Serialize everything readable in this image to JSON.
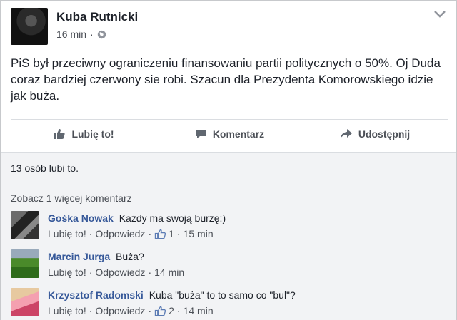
{
  "post": {
    "author": "Kuba Rutnicki",
    "time": "16 min",
    "separator": "·",
    "text": "PiS był przeciwny ograniczeniu finansowaniu partii politycznych o 50%. Oj Duda coraz bardziej czerwony sie robi. Szacun dla Prezydenta Komorowskiego idzie jak buża."
  },
  "actions": {
    "like": "Lubię to!",
    "comment": "Komentarz",
    "share": "Udostępnij"
  },
  "likes_summary": "13 osób lubi to.",
  "more_comments": "Zobacz 1 więcej komentarz",
  "comments": [
    {
      "name": "Gośka Nowak",
      "text": "Każdy ma swoją burzę:)",
      "like": "Lubię to!",
      "dot1": "·",
      "reply": "Odpowiedz",
      "dot2": "·",
      "likes": "1",
      "dot3": "·",
      "time": "15 min"
    },
    {
      "name": "Marcin Jurga",
      "text": "Buża?",
      "like": "Lubię to!",
      "dot1": "·",
      "reply": "Odpowiedz",
      "dot2": "·",
      "time": "14 min"
    },
    {
      "name": "Krzysztof Radomski",
      "text": "Kuba \"buża\" to to samo co \"bul\"?",
      "like": "Lubię to!",
      "dot1": "·",
      "reply": "Odpowiedz",
      "dot2": "·",
      "likes": "2",
      "dot3": "·",
      "time": "14 min"
    }
  ],
  "colors": {
    "link": "#365899",
    "muted": "#4b4f56",
    "comments_bg": "#f2f3f5"
  }
}
